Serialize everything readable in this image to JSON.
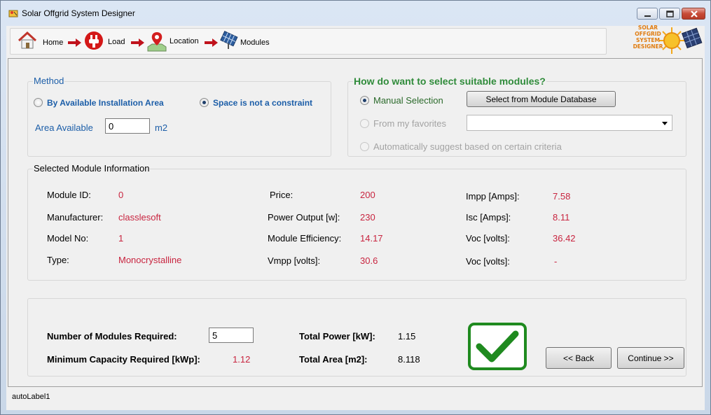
{
  "window": {
    "title": "Solar Offgrid System Designer",
    "accent_color": "#1c5ea8"
  },
  "nav": {
    "items": [
      {
        "label": "Home",
        "icon": "house-icon"
      },
      {
        "label": "Load",
        "icon": "power-plug-icon"
      },
      {
        "label": "Location",
        "icon": "map-pin-icon"
      },
      {
        "label": "Modules",
        "icon": "solar-panel-icon"
      }
    ]
  },
  "logo": {
    "lines": [
      "SOLAR",
      "OFFGRID",
      "SYSTEM",
      "DESIGNER"
    ]
  },
  "method": {
    "title": "Method",
    "option_area": "By Available Installation Area",
    "option_space": "Space is not a constraint",
    "selected": "space",
    "area_label": "Area Available",
    "area_value": "0",
    "area_unit": "m2"
  },
  "selection": {
    "title": "How do want to select suitable modules?",
    "manual": "Manual Selection",
    "db_button": "Select from Module Database",
    "favorites": "From my favorites",
    "favorites_value": "",
    "auto": "Automatically suggest based on certain criteria"
  },
  "module_info": {
    "title": "Selected Module Information",
    "col1": [
      {
        "label": "Module ID:",
        "value": "0"
      },
      {
        "label": "Manufacturer:",
        "value": "classlesoft"
      },
      {
        "label": "Model No:",
        "value": "1"
      },
      {
        "label": "Type:",
        "value": "Monocrystalline"
      }
    ],
    "col2": [
      {
        "label": "Price:",
        "value": "200"
      },
      {
        "label": "Power Output [w]:",
        "value": "230"
      },
      {
        "label": "Module Efficiency:",
        "value": "14.17"
      },
      {
        "label": "Vmpp [volts]:",
        "value": "30.6"
      }
    ],
    "col3": [
      {
        "label": "Impp [Amps]:",
        "value": "7.58"
      },
      {
        "label": "Isc [Amps]:",
        "value": "8.11"
      },
      {
        "label": "Voc [volts]:",
        "value": "36.42"
      },
      {
        "label": "Voc [volts]:",
        "value": "-"
      }
    ]
  },
  "results": {
    "modules_label": "Number of Modules Required:",
    "modules_value": "5",
    "min_cap_label": "Minimum Capacity Required [kWp]:",
    "min_cap_value": "1.12",
    "total_power_label": "Total Power [kW]:",
    "total_power_value": "1.15",
    "total_area_label": "Total Area [m2]:",
    "total_area_value": "8.118"
  },
  "buttons": {
    "back": "<< Back",
    "continue": "Continue >>"
  },
  "status": {
    "text": "autoLabel1"
  }
}
